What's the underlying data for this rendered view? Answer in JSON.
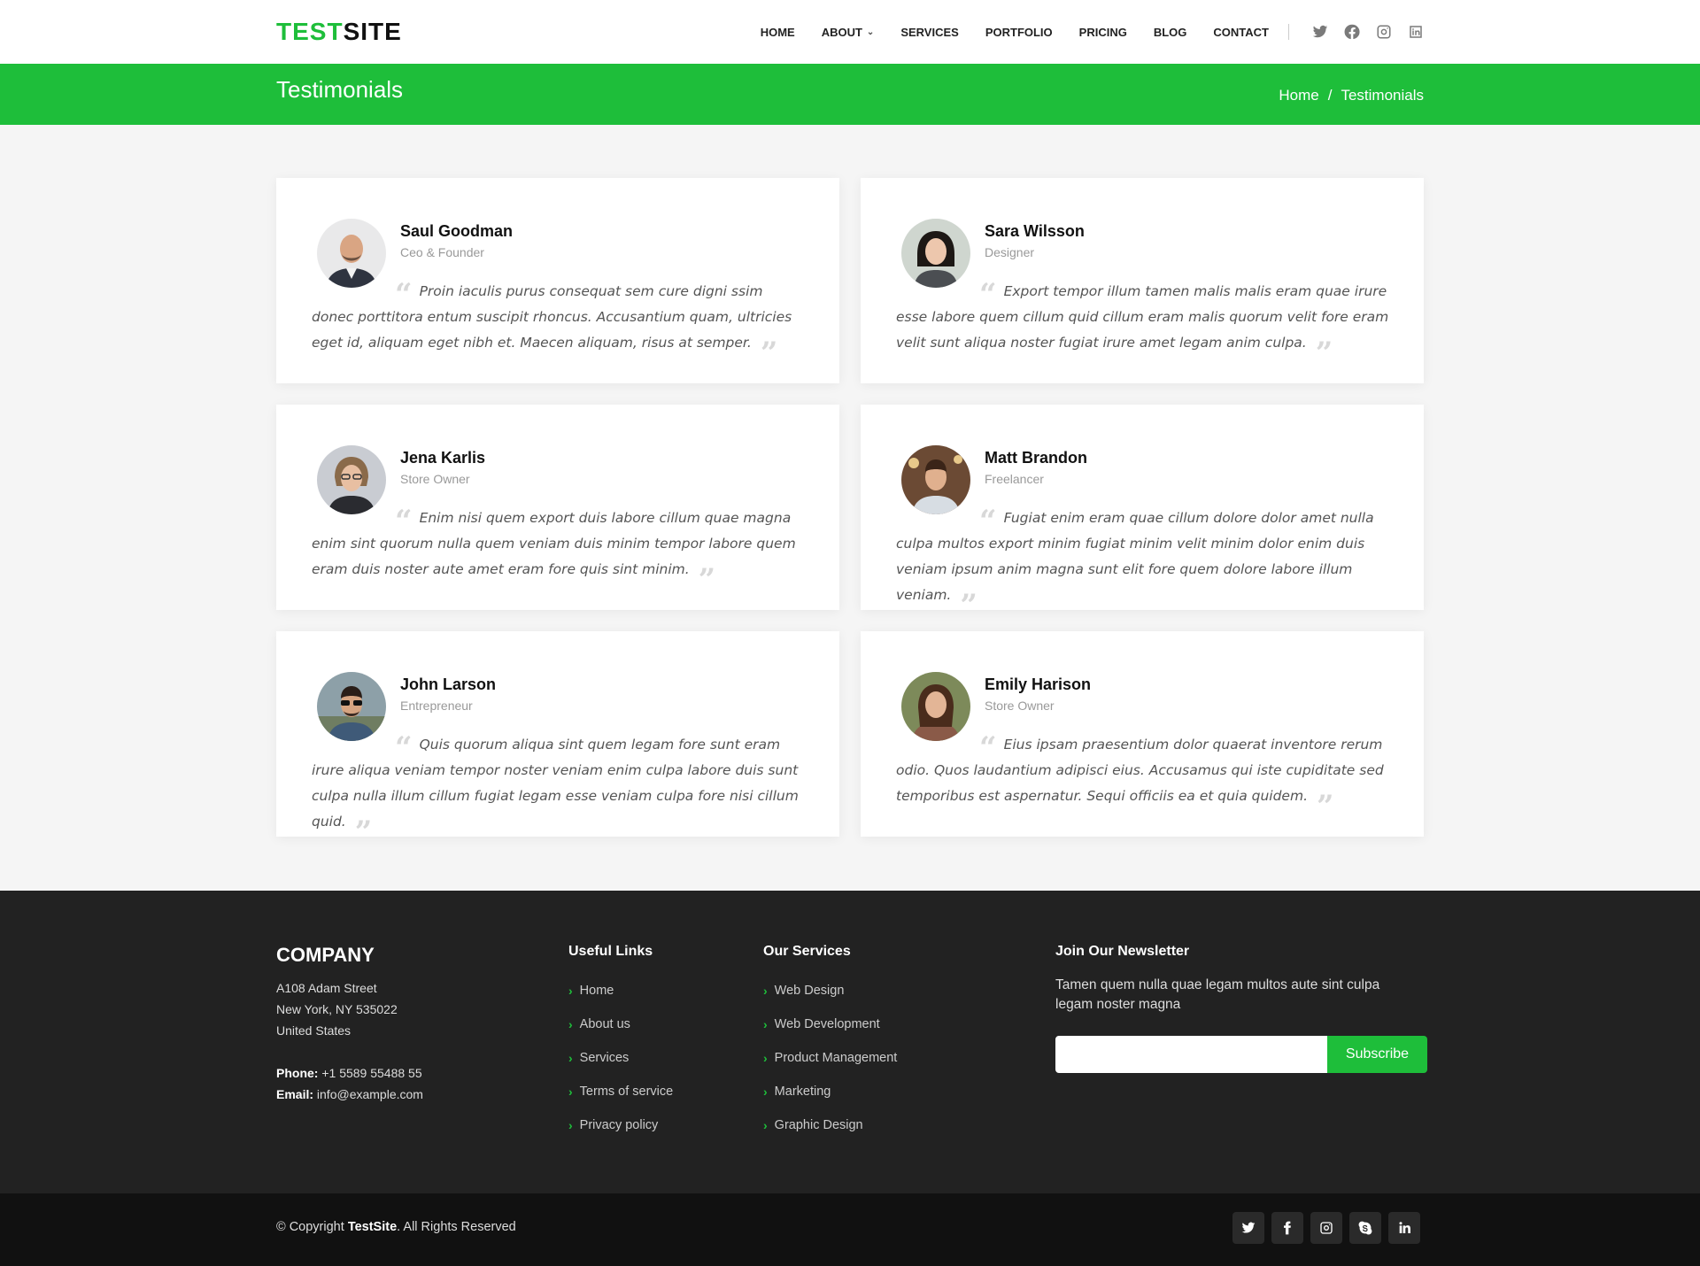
{
  "brand": {
    "part1": "TEST",
    "part2": "SITE",
    "accent_color": "#1ebe3a"
  },
  "nav": {
    "items": [
      "HOME",
      "ABOUT",
      "SERVICES",
      "PORTFOLIO",
      "PRICING",
      "BLOG",
      "CONTACT"
    ],
    "social_icons": [
      "twitter-icon",
      "facebook-icon",
      "instagram-icon",
      "linkedin-icon"
    ]
  },
  "titlebar": {
    "title": "Testimonials",
    "breadcrumb_home": "Home",
    "breadcrumb_sep": "/",
    "breadcrumb_current": "Testimonials"
  },
  "testimonials": [
    {
      "name": "Saul Goodman",
      "role": "Ceo & Founder",
      "text": "Proin iaculis purus consequat sem cure digni ssim donec porttitora entum suscipit rhoncus. Accusantium quam, ultricies eget id, aliquam eget nibh et. Maecen aliquam, risus at semper."
    },
    {
      "name": "Sara Wilsson",
      "role": "Designer",
      "text": "Export tempor illum tamen malis malis eram quae irure esse labore quem cillum quid cillum eram malis quorum velit fore eram velit sunt aliqua noster fugiat irure amet legam anim culpa."
    },
    {
      "name": "Jena Karlis",
      "role": "Store Owner",
      "text": "Enim nisi quem export duis labore cillum quae magna enim sint quorum nulla quem veniam duis minim tempor labore quem eram duis noster aute amet eram fore quis sint minim."
    },
    {
      "name": "Matt Brandon",
      "role": "Freelancer",
      "text": "Fugiat enim eram quae cillum dolore dolor amet nulla culpa multos export minim fugiat minim velit minim dolor enim duis veniam ipsum anim magna sunt elit fore quem dolore labore illum veniam."
    },
    {
      "name": "John Larson",
      "role": "Entrepreneur",
      "text": "Quis quorum aliqua sint quem legam fore sunt eram irure aliqua veniam tempor noster veniam enim culpa labore duis sunt culpa nulla illum cillum fugiat legam esse veniam culpa fore nisi cillum quid."
    },
    {
      "name": "Emily Harison",
      "role": "Store Owner",
      "text": "Eius ipsam praesentium dolor quaerat inventore rerum odio. Quos laudantium adipisci eius. Accusamus qui iste cupiditate sed temporibus est aspernatur. Sequi officiis ea et quia quidem."
    }
  ],
  "footer": {
    "company": {
      "title": "COMPANY",
      "address1": "A108 Adam Street",
      "address2": "New York, NY 535022",
      "address3": "United States",
      "phone_label": "Phone:",
      "phone": "+1 5589 55488 55",
      "email_label": "Email:",
      "email": "info@example.com"
    },
    "useful_links": {
      "title": "Useful Links",
      "items": [
        "Home",
        "About us",
        "Services",
        "Terms of service",
        "Privacy policy"
      ]
    },
    "services": {
      "title": "Our Services",
      "items": [
        "Web Design",
        "Web Development",
        "Product Management",
        "Marketing",
        "Graphic Design"
      ]
    },
    "newsletter": {
      "title": "Join Our Newsletter",
      "text": "Tamen quem nulla quae legam multos aute sint culpa legam noster magna",
      "input_value": "",
      "button": "Subscribe"
    }
  },
  "bottom": {
    "copyright_prefix": "© Copyright",
    "brand": "TestSite",
    "copyright_suffix": ". All Rights Reserved",
    "social_icons": [
      "twitter-icon",
      "facebook-icon",
      "instagram-icon",
      "skype-icon",
      "linkedin-icon"
    ]
  }
}
